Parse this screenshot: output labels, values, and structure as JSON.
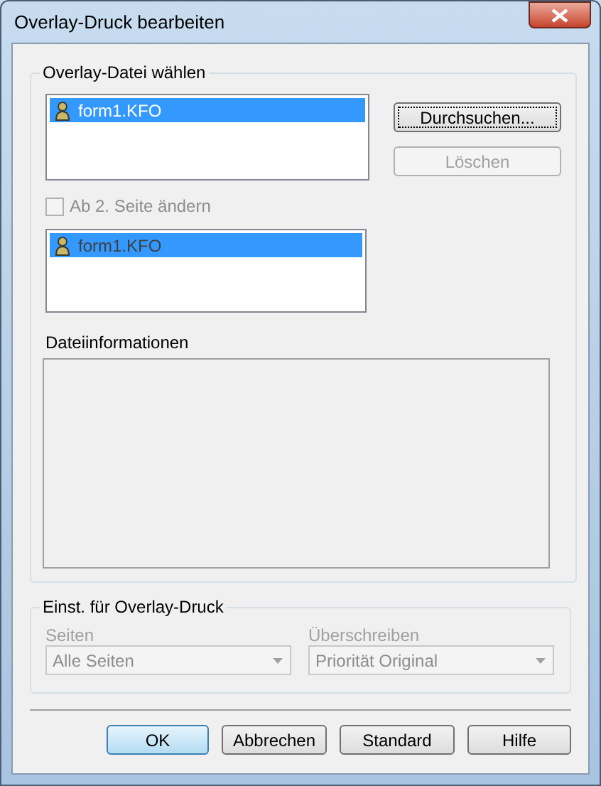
{
  "window": {
    "title": "Overlay-Druck bearbeiten"
  },
  "overlay_file": {
    "title": "Overlay-Datei wählen",
    "files": [
      {
        "name": "form1.KFO",
        "selected": true
      }
    ],
    "actions": [
      {
        "label": "Durchsuchen...",
        "disabled": false,
        "focused": true
      },
      {
        "label": "Löschen",
        "disabled": true,
        "focused": false
      }
    ],
    "from_page_2": {
      "label": "Ab 2. Seite ändern",
      "checked": false,
      "disabled": true
    },
    "files_page_2": {
      "disabled": true,
      "items": [
        {
          "name": "form1.KFO",
          "selected": true
        }
      ]
    },
    "file_info": {
      "label": "Dateiinformationen"
    }
  },
  "settings": {
    "title": "Einst. für Overlay-Druck",
    "fields": [
      {
        "label": "Seiten",
        "value": "Alle Seiten",
        "disabled": true
      },
      {
        "label": "Überschreiben",
        "value": "Priorität Original",
        "disabled": true
      }
    ]
  },
  "buttons": [
    {
      "label": "OK",
      "default": true
    },
    {
      "label": "Abbrechen",
      "default": false
    },
    {
      "label": "Standard",
      "default": false
    },
    {
      "label": "Hilfe",
      "default": false
    }
  ]
}
